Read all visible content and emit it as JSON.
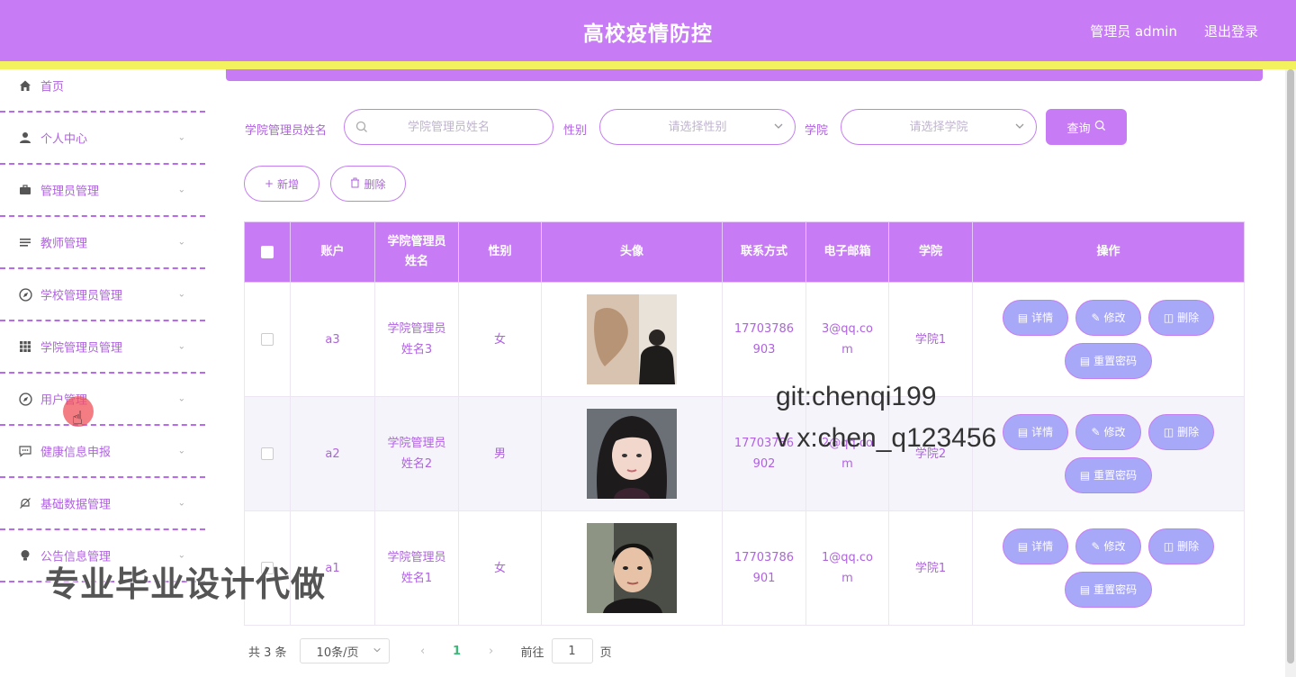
{
  "header": {
    "title": "高校疫情防控",
    "user": "管理员 admin",
    "logout": "退出登录",
    "color": "#c77cf5",
    "stripe_color": "#f4f15f"
  },
  "sidebar": {
    "items": [
      {
        "label": "首页",
        "icon": "home-icon",
        "has_arrow": false
      },
      {
        "label": "个人中心",
        "icon": "user-icon",
        "has_arrow": true
      },
      {
        "label": "管理员管理",
        "icon": "briefcase-icon",
        "has_arrow": true
      },
      {
        "label": "教师管理",
        "icon": "list-icon",
        "has_arrow": true
      },
      {
        "label": "学校管理员管理",
        "icon": "compass-icon",
        "has_arrow": true
      },
      {
        "label": "学院管理员管理",
        "icon": "grid-icon",
        "has_arrow": true
      },
      {
        "label": "用户管理",
        "icon": "compass-icon",
        "has_arrow": true
      },
      {
        "label": "健康信息申报",
        "icon": "chat-icon",
        "has_arrow": true
      },
      {
        "label": "基础数据管理",
        "icon": "bell-off-icon",
        "has_arrow": true
      },
      {
        "label": "公告信息管理",
        "icon": "bulb-icon",
        "has_arrow": true
      }
    ]
  },
  "search": {
    "name_label": "学院管理员姓名",
    "name_placeholder": "学院管理员姓名",
    "gender_label": "性别",
    "gender_placeholder": "请选择性别",
    "college_label": "学院",
    "college_placeholder": "请选择学院",
    "query_button": "查询"
  },
  "actions": {
    "add": "新增",
    "delete": "删除"
  },
  "table": {
    "columns": [
      "账户",
      "学院管理员姓名",
      "性别",
      "头像",
      "联系方式",
      "电子邮箱",
      "学院",
      "操作"
    ],
    "rows": [
      {
        "account": "a3",
        "name": "学院管理员姓名3",
        "gender": "女",
        "avatar": "avatar-woman-back",
        "phone": "17703786903",
        "email": "3@qq.com",
        "college": "学院1"
      },
      {
        "account": "a2",
        "name": "学院管理员姓名2",
        "gender": "男",
        "avatar": "avatar-girl",
        "phone": "17703786902",
        "email": "2@qq.com",
        "college": "学院2"
      },
      {
        "account": "a1",
        "name": "学院管理员姓名1",
        "gender": "女",
        "avatar": "avatar-man",
        "phone": "17703786901",
        "email": "1@qq.com",
        "college": "学院1"
      }
    ],
    "row_actions": {
      "detail": "详情",
      "edit": "修改",
      "delete": "删除",
      "reset": "重置密码"
    }
  },
  "pagination": {
    "total": "共 3 条",
    "page_size": "10条/页",
    "current": "1",
    "goto_label": "前往",
    "goto_value": "1",
    "page_suffix": "页"
  },
  "overlays": {
    "git": "git:chenqi199",
    "wx": "v x:chen_q123456",
    "promo": "专业毕业设计代做"
  }
}
